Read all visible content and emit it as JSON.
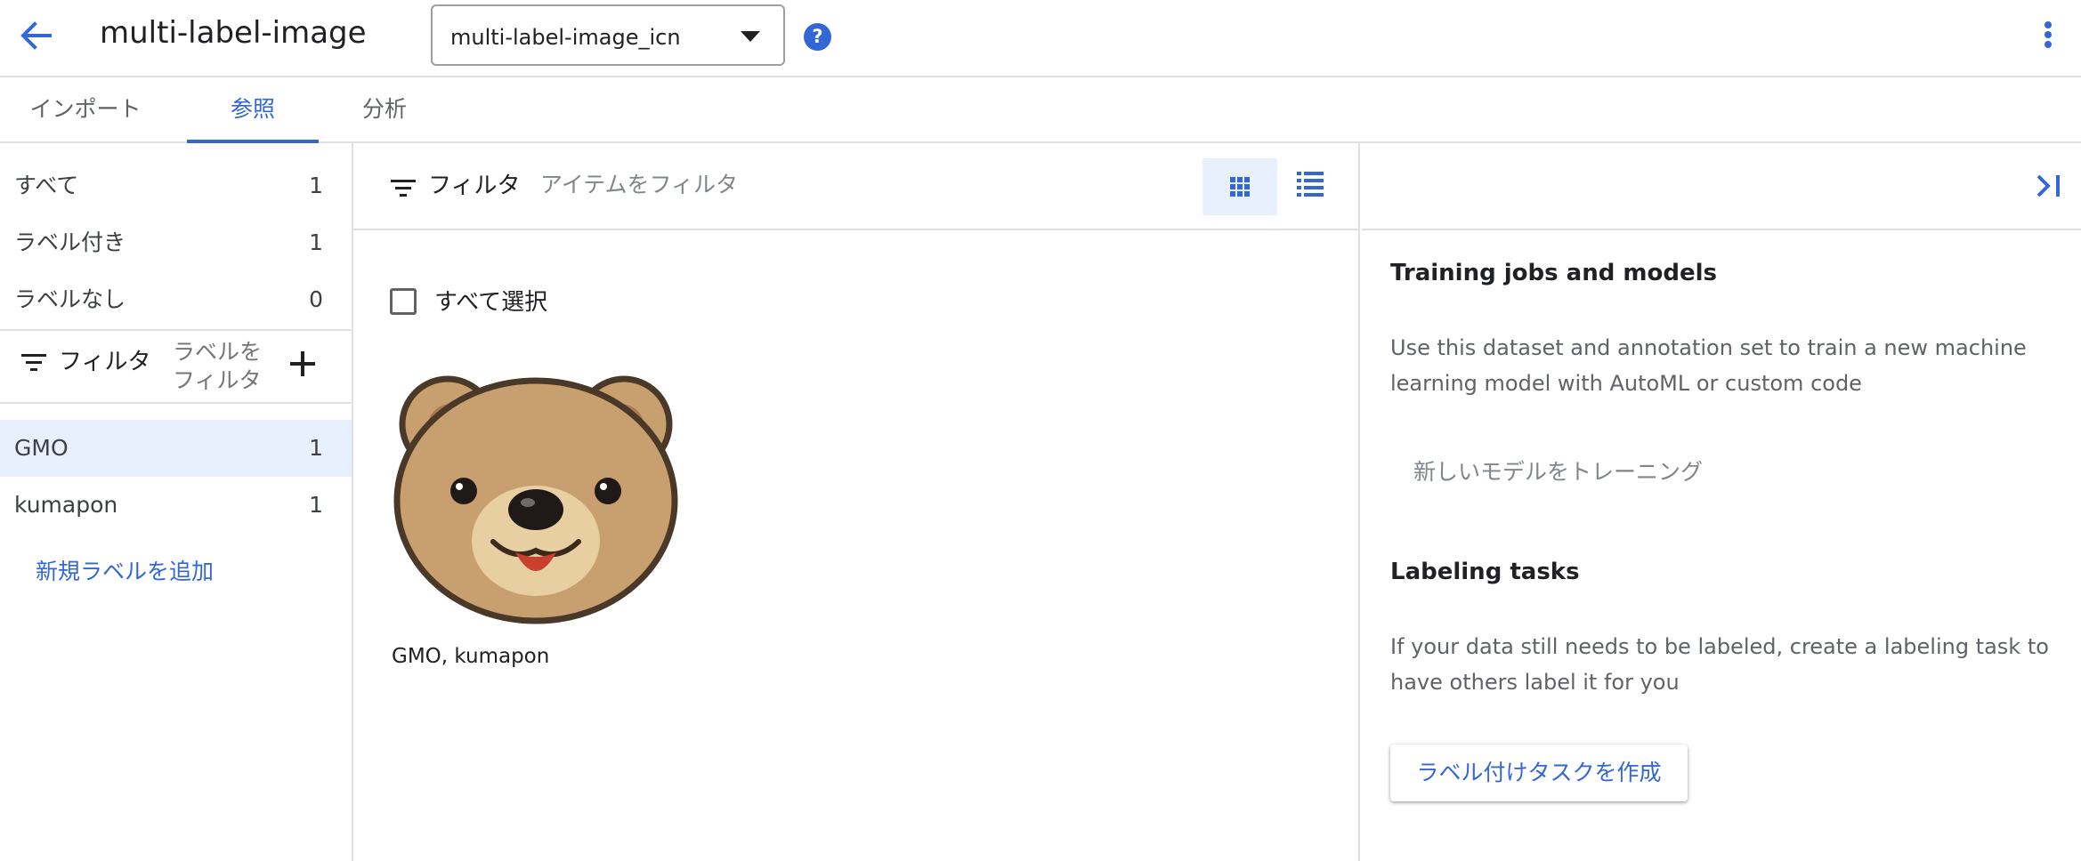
{
  "header": {
    "title": "multi-label-image",
    "dataset_select_value": "multi-label-image_icn",
    "help_glyph": "?"
  },
  "tabs": [
    {
      "label": "インポート",
      "active": false
    },
    {
      "label": "参照",
      "active": true
    },
    {
      "label": "分析",
      "active": false
    }
  ],
  "sidebar": {
    "counts": [
      {
        "label": "すべて",
        "count": "1"
      },
      {
        "label": "ラベル付き",
        "count": "1"
      },
      {
        "label": "ラベルなし",
        "count": "0"
      }
    ],
    "filter_label": "フィルタ",
    "filter_placeholder": "ラベルを\nフィルタ",
    "labels": [
      {
        "label": "GMO",
        "count": "1",
        "selected": true
      },
      {
        "label": "kumapon",
        "count": "1",
        "selected": false
      }
    ],
    "add_label": "新規ラベルを追加"
  },
  "center": {
    "filter_label": "フィルタ",
    "filter_placeholder": "アイテムをフィルタ",
    "select_all": "すべて選択",
    "items": [
      {
        "caption": "GMO, kumapon",
        "image": "bear-face-image"
      }
    ]
  },
  "right": {
    "training": {
      "title": "Training jobs and models",
      "description": "Use this dataset and annotation set to train a new machine learning model with AutoML or custom code",
      "button": "新しいモデルをトレーニング"
    },
    "labeling": {
      "title": "Labeling tasks",
      "description": "If your data still needs to be labeled, create a labeling task to have others label it for you",
      "button": "ラベル付けタスクを作成"
    }
  },
  "colors": {
    "accent": "#3367d6",
    "selected_bg": "#e8f0fe",
    "divider": "#e0e0e0",
    "muted_text": "#80868b"
  },
  "icons": [
    "arrow-back-icon",
    "dropdown-caret-icon",
    "help-icon",
    "more-vert-icon",
    "filter-icon",
    "add-icon",
    "grid-view-icon",
    "list-view-icon",
    "checkbox-icon",
    "collapse-panel-icon"
  ]
}
